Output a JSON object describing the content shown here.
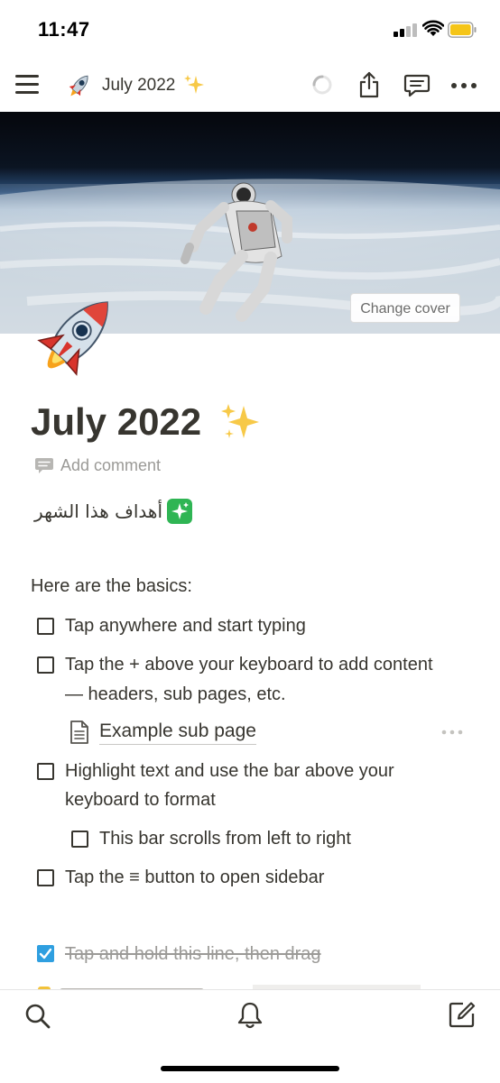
{
  "status_bar": {
    "time": "11:47"
  },
  "nav": {
    "page_icon": "🚀",
    "title": "July 2022",
    "title_emoji": "✨",
    "icons": [
      "menu-icon",
      "loading-spinner-icon",
      "share-icon",
      "comment-icon",
      "more-icon"
    ]
  },
  "cover": {
    "change_cover_label": "Change cover"
  },
  "page": {
    "title": "July 2022",
    "title_emoji": "✨",
    "add_comment_label": "Add comment",
    "arabic_line": "أهداف هذا الشهر",
    "basics_heading": "Here are the basics:",
    "todos": [
      {
        "text": "Tap anywhere and start typing",
        "checked": false
      },
      {
        "text_line1": "Tap the + above your keyboard to add content",
        "text_line2": "— headers, sub pages, etc.",
        "checked": false
      },
      {
        "text_line1": "Highlight text and use the bar above your",
        "text_line2": "keyboard to format",
        "checked": false
      },
      {
        "text": "This bar scrolls from left to right",
        "checked": false
      },
      {
        "text": "Tap the ≡ button to open sidebar",
        "checked": false
      },
      {
        "text": "Tap and hold this line, then drag",
        "checked": true
      }
    ],
    "sub_page": {
      "label": "Example sub page"
    }
  },
  "bottom_bar": {
    "icons": [
      "search-icon",
      "bell-icon",
      "compose-icon"
    ]
  },
  "colors": {
    "text": "#37352f",
    "muted": "#9b9a97",
    "checkbox_checked": "#2f9fe0",
    "sparkle_green": "#2fb554"
  }
}
